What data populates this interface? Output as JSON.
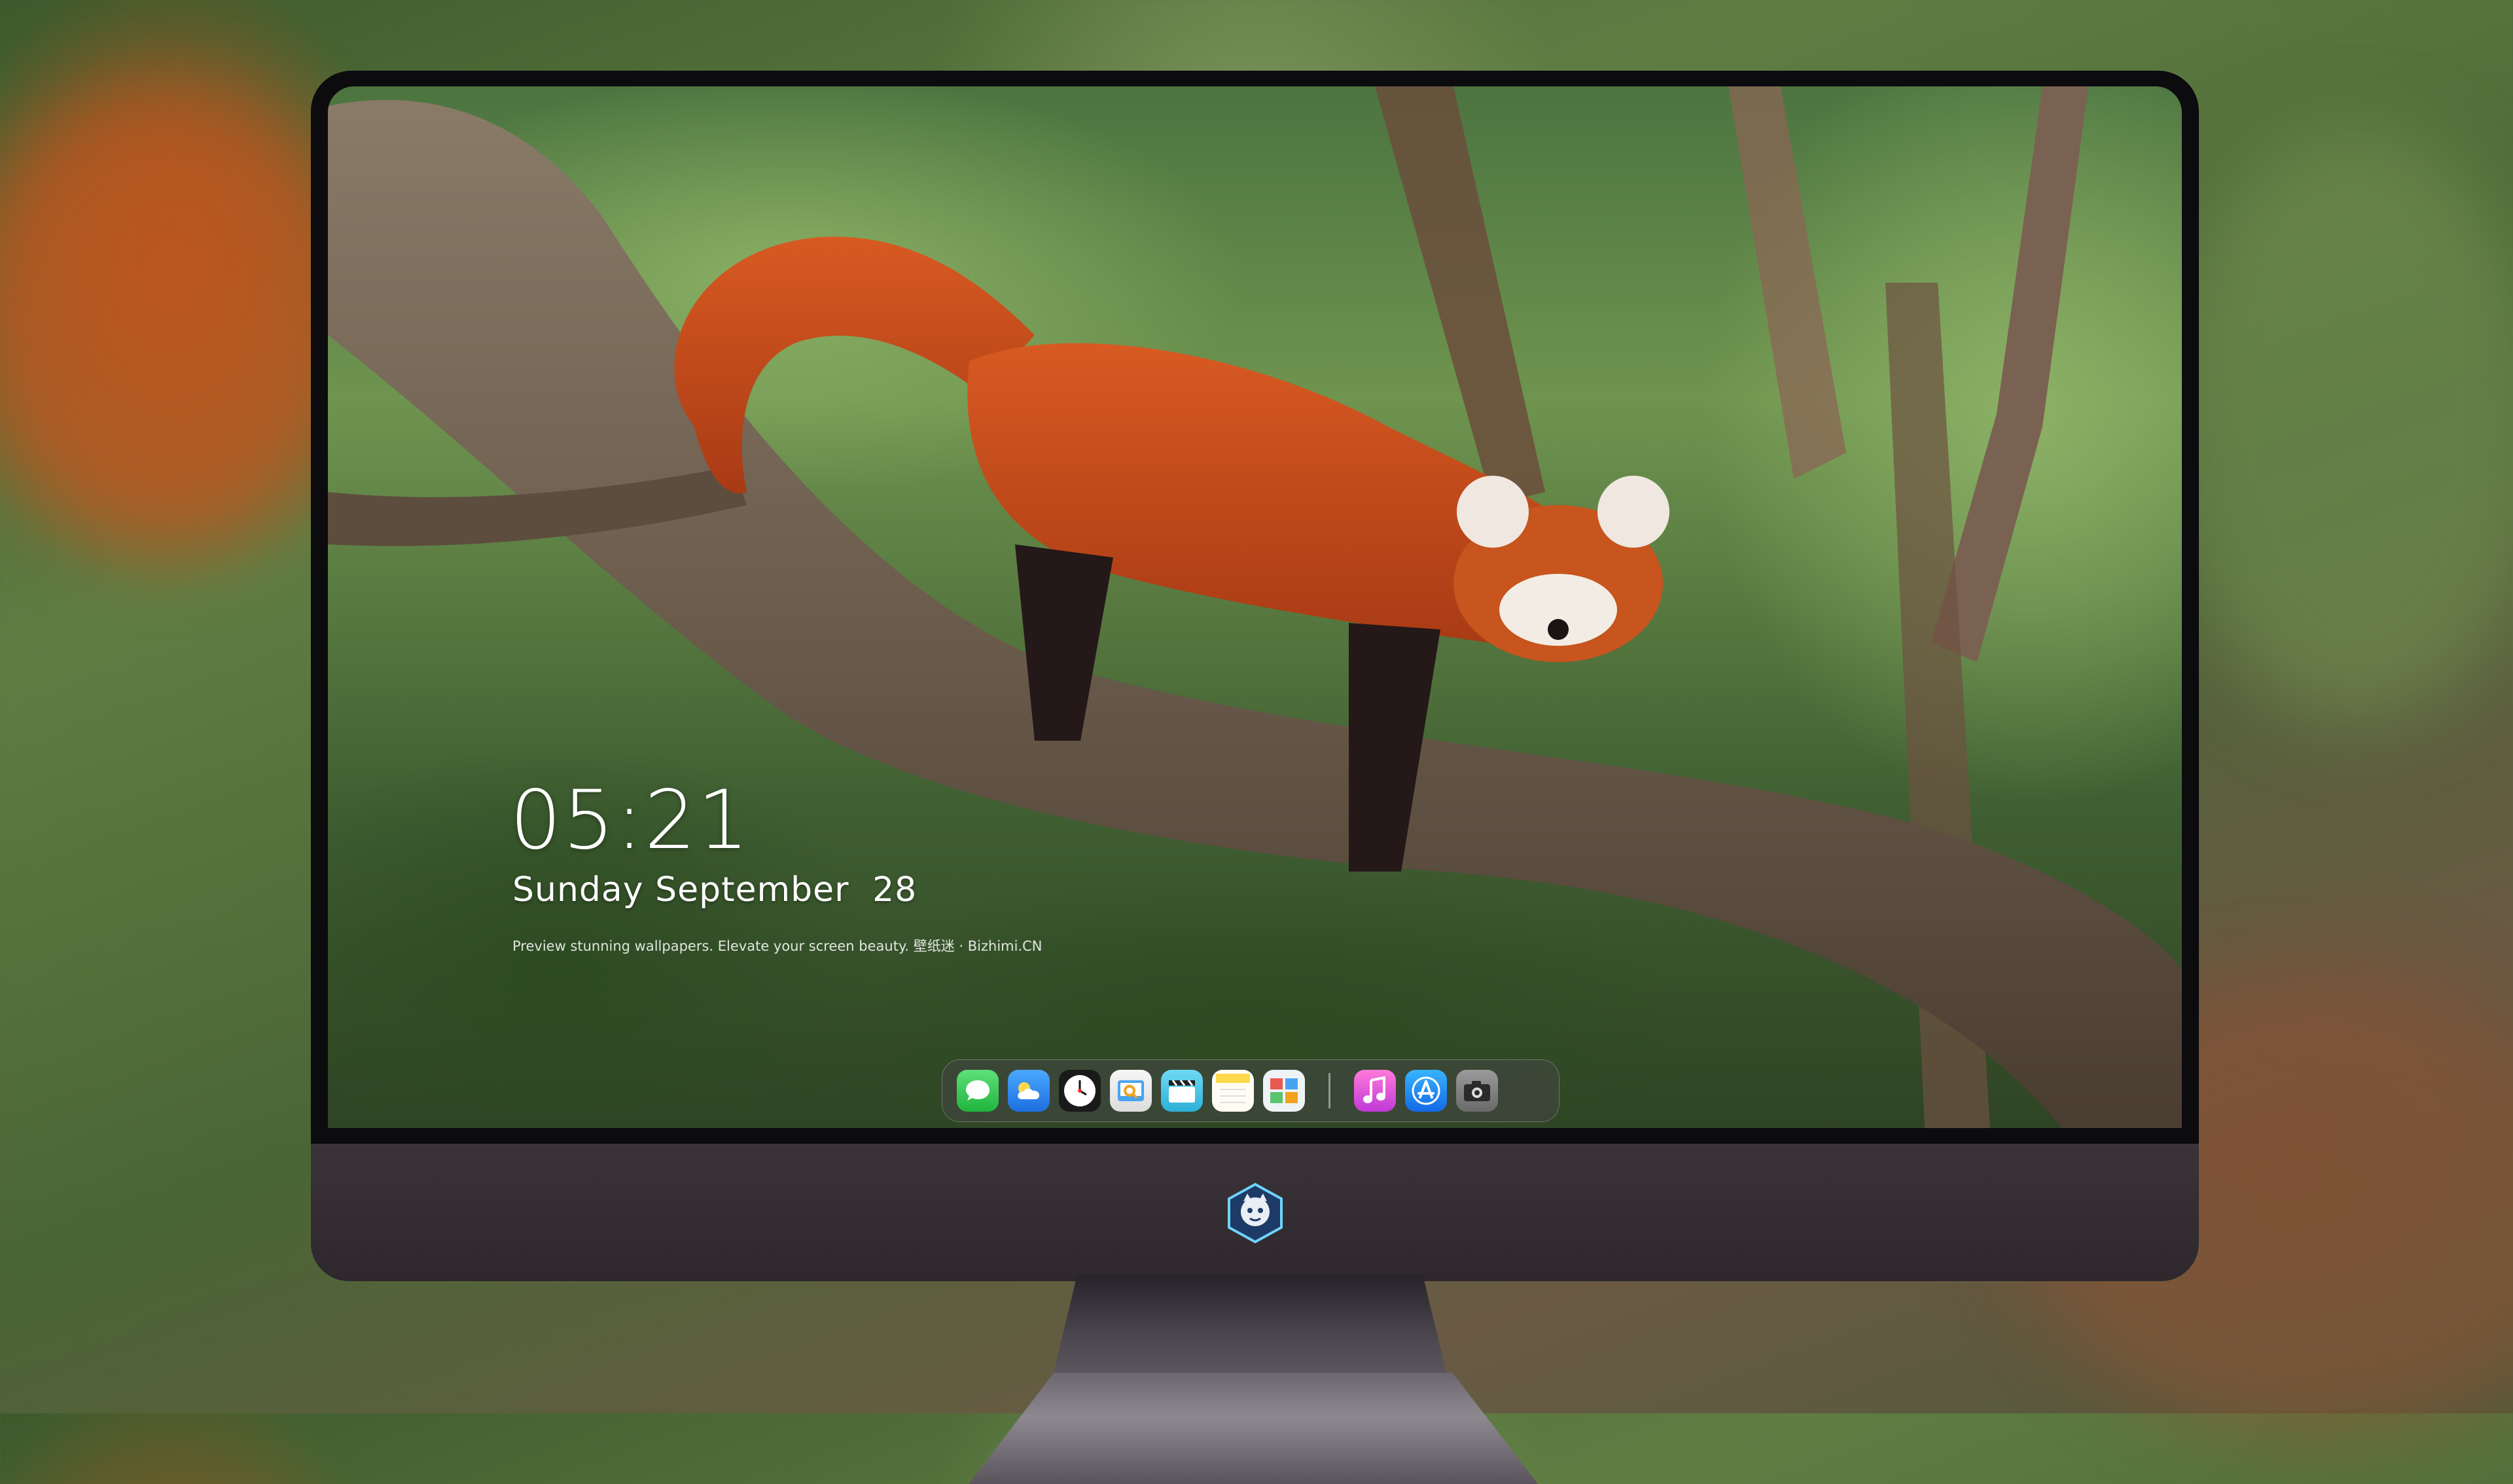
{
  "lockscreen": {
    "time": "05:21",
    "weekday": "Sunday",
    "month": "September",
    "day": "28",
    "tagline": "Preview stunning wallpapers. Elevate your screen beauty. 壁纸迷 · Bizhimi.CN"
  },
  "dock": {
    "apps": [
      {
        "name": "messages-icon",
        "color": "#34c759"
      },
      {
        "name": "weather-icon",
        "color": "#2f8cf5"
      },
      {
        "name": "clock-icon",
        "color": "#ffffff"
      },
      {
        "name": "preview-icon",
        "color": "#f2c94c"
      },
      {
        "name": "clapperboard-icon",
        "color": "#4ac7e8"
      },
      {
        "name": "notes-icon",
        "color": "#ffd84d"
      },
      {
        "name": "photo-booth-icon",
        "color": "#e8eef2"
      },
      {
        "name": "music-icon",
        "color": "#f05bc4"
      },
      {
        "name": "app-store-icon",
        "color": "#1e8df5"
      },
      {
        "name": "camera-icon",
        "color": "#8a8a8a"
      }
    ]
  },
  "colors": {
    "fur": "#c24a1c",
    "bezel": "#0c0b0e",
    "chin": "#352f34"
  }
}
